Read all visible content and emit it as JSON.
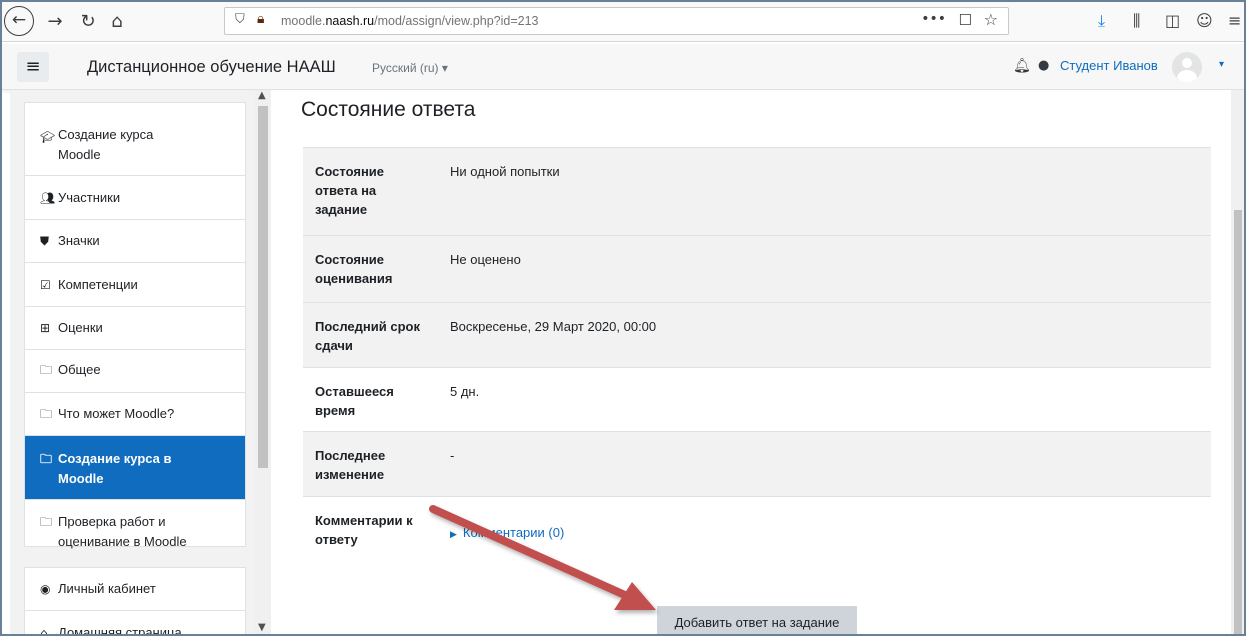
{
  "browser": {
    "back_icon": "back-arrow-icon",
    "forward_icon": "forward-arrow-icon",
    "reload_icon": "reload-icon",
    "home_icon": "home-icon",
    "url_domain": "moodle.naash.ru",
    "url_path": "/mod/assign/view.php?id=213",
    "url_prefix": "moodle."
  },
  "navbar": {
    "site_name": "Дистанционное обучение НААШ",
    "language": "Русский (ru) ▾",
    "user_name": "Студент Иванов",
    "caret": "▾"
  },
  "sidebar": {
    "items": [
      {
        "label": "Создание курса Moodle",
        "icon": "graduation-cap-icon"
      },
      {
        "label": "Участники",
        "icon": "users-icon"
      },
      {
        "label": "Значки",
        "icon": "shield-icon"
      },
      {
        "label": "Компетенции",
        "icon": "checkbox-icon"
      },
      {
        "label": "Оценки",
        "icon": "table-icon"
      },
      {
        "label": "Общее",
        "icon": "folder-icon"
      },
      {
        "label": "Что может Moodle?",
        "icon": "folder-icon"
      },
      {
        "label": "Создание курса в Moodle",
        "icon": "folder-icon",
        "active": true
      },
      {
        "label": "Проверка работ и оценивание в Moodle",
        "icon": "folder-icon"
      }
    ],
    "items2": [
      {
        "label": "Личный кабинет",
        "icon": "dashboard-icon"
      },
      {
        "label": "Домашняя страница",
        "icon": "home-icon"
      }
    ]
  },
  "main": {
    "section_title": "Состояние ответа",
    "rows": [
      {
        "key": "Состояние ответа на задание",
        "value": "Ни одной попытки"
      },
      {
        "key": "Состояние оценивания",
        "value": "Не оценено"
      },
      {
        "key": "Последний срок сдачи",
        "value": "Воскресенье, 29 Март 2020, 00:00"
      },
      {
        "key": "Оставшееся время",
        "value": "5 дн."
      },
      {
        "key": "Последнее изменение",
        "value": "-"
      },
      {
        "key": "Комментарии к ответу",
        "value": "Комментарии (0)"
      }
    ],
    "submit_button": "Добавить ответ на задание"
  },
  "colors": {
    "accent": "#0f6cbf",
    "arrow": "#c0504d"
  }
}
